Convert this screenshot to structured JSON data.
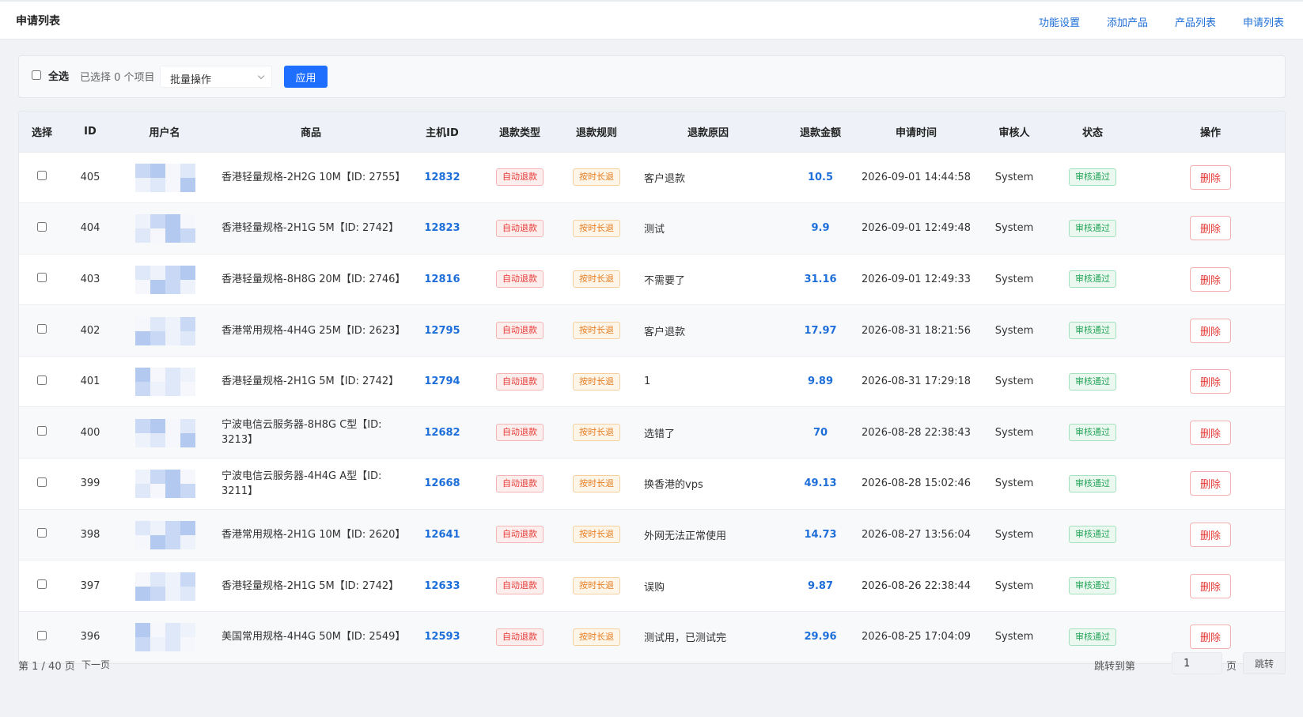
{
  "header": {
    "title": "申请列表",
    "nav": [
      "功能设置",
      "添加产品",
      "产品列表",
      "申请列表"
    ]
  },
  "bulk": {
    "select_all": "全选",
    "selected_count": "已选择 0 个项目",
    "action_select": "批量操作",
    "apply": "应用"
  },
  "table": {
    "columns": [
      "选择",
      "ID",
      "用户名",
      "商品",
      "主机ID",
      "退款类型",
      "退款规则",
      "退款原因",
      "退款金额",
      "申请时间",
      "审核人",
      "状态",
      "操作"
    ],
    "rows": [
      {
        "id": "405",
        "goods": "香港轻量规格-2H2G 10M【ID: 2755】",
        "host_id": "12832",
        "refund_type": "自动退款",
        "refund_rule": "按时长退",
        "reason": "客户退款",
        "amount": "10.5",
        "time": "2026-09-01 14:44:58",
        "reviewer": "System",
        "status": "审核通过",
        "action": "删除"
      },
      {
        "id": "404",
        "goods": "香港轻量规格-2H1G 5M【ID: 2742】",
        "host_id": "12823",
        "refund_type": "自动退款",
        "refund_rule": "按时长退",
        "reason": "测试",
        "amount": "9.9",
        "time": "2026-09-01 12:49:48",
        "reviewer": "System",
        "status": "审核通过",
        "action": "删除"
      },
      {
        "id": "403",
        "goods": "香港轻量规格-8H8G 20M【ID: 2746】",
        "host_id": "12816",
        "refund_type": "自动退款",
        "refund_rule": "按时长退",
        "reason": "不需要了",
        "amount": "31.16",
        "time": "2026-09-01 12:49:33",
        "reviewer": "System",
        "status": "审核通过",
        "action": "删除"
      },
      {
        "id": "402",
        "goods": "香港常用规格-4H4G 25M【ID: 2623】",
        "host_id": "12795",
        "refund_type": "自动退款",
        "refund_rule": "按时长退",
        "reason": "客户退款",
        "amount": "17.97",
        "time": "2026-08-31 18:21:56",
        "reviewer": "System",
        "status": "审核通过",
        "action": "删除"
      },
      {
        "id": "401",
        "goods": "香港轻量规格-2H1G 5M【ID: 2742】",
        "host_id": "12794",
        "refund_type": "自动退款",
        "refund_rule": "按时长退",
        "reason": "1",
        "amount": "9.89",
        "time": "2026-08-31 17:29:18",
        "reviewer": "System",
        "status": "审核通过",
        "action": "删除"
      },
      {
        "id": "400",
        "goods": "宁波电信云服务器-8H8G C型【ID: 3213】",
        "host_id": "12682",
        "refund_type": "自动退款",
        "refund_rule": "按时长退",
        "reason": "选错了",
        "amount": "70",
        "time": "2026-08-28 22:38:43",
        "reviewer": "System",
        "status": "审核通过",
        "action": "删除"
      },
      {
        "id": "399",
        "goods": "宁波电信云服务器-4H4G A型【ID: 3211】",
        "host_id": "12668",
        "refund_type": "自动退款",
        "refund_rule": "按时长退",
        "reason": "换香港的vps",
        "amount": "49.13",
        "time": "2026-08-28 15:02:46",
        "reviewer": "System",
        "status": "审核通过",
        "action": "删除"
      },
      {
        "id": "398",
        "goods": "香港常用规格-2H1G 10M【ID: 2620】",
        "host_id": "12641",
        "refund_type": "自动退款",
        "refund_rule": "按时长退",
        "reason": "外网无法正常使用",
        "amount": "14.73",
        "time": "2026-08-27 13:56:04",
        "reviewer": "System",
        "status": "审核通过",
        "action": "删除"
      },
      {
        "id": "397",
        "goods": "香港轻量规格-2H1G 5M【ID: 2742】",
        "host_id": "12633",
        "refund_type": "自动退款",
        "refund_rule": "按时长退",
        "reason": "误购",
        "amount": "9.87",
        "time": "2026-08-26 22:38:44",
        "reviewer": "System",
        "status": "审核通过",
        "action": "删除"
      },
      {
        "id": "396",
        "goods": "美国常用规格-4H4G 50M【ID: 2549】",
        "host_id": "12593",
        "refund_type": "自动退款",
        "refund_rule": "按时长退",
        "reason": "测试用，已测试完",
        "amount": "29.96",
        "time": "2026-08-25 17:04:09",
        "reviewer": "System",
        "status": "审核通过",
        "action": "删除"
      }
    ]
  },
  "pager": {
    "info": "第 1 / 40 页",
    "next": "下一页",
    "jump_label": "跳转到第",
    "jump_value": "1",
    "page_unit": "页",
    "jump_button": "跳转"
  },
  "colors": {
    "primary": "#1e6fff",
    "link": "#1e6fd9",
    "danger": "#e53935",
    "warning": "#e67e22",
    "success": "#27a55a",
    "mosaic": [
      "#c9d9f5",
      "#dfe8f8",
      "#b4c9f0",
      "#eef3fb",
      "#f5f7fc"
    ]
  }
}
